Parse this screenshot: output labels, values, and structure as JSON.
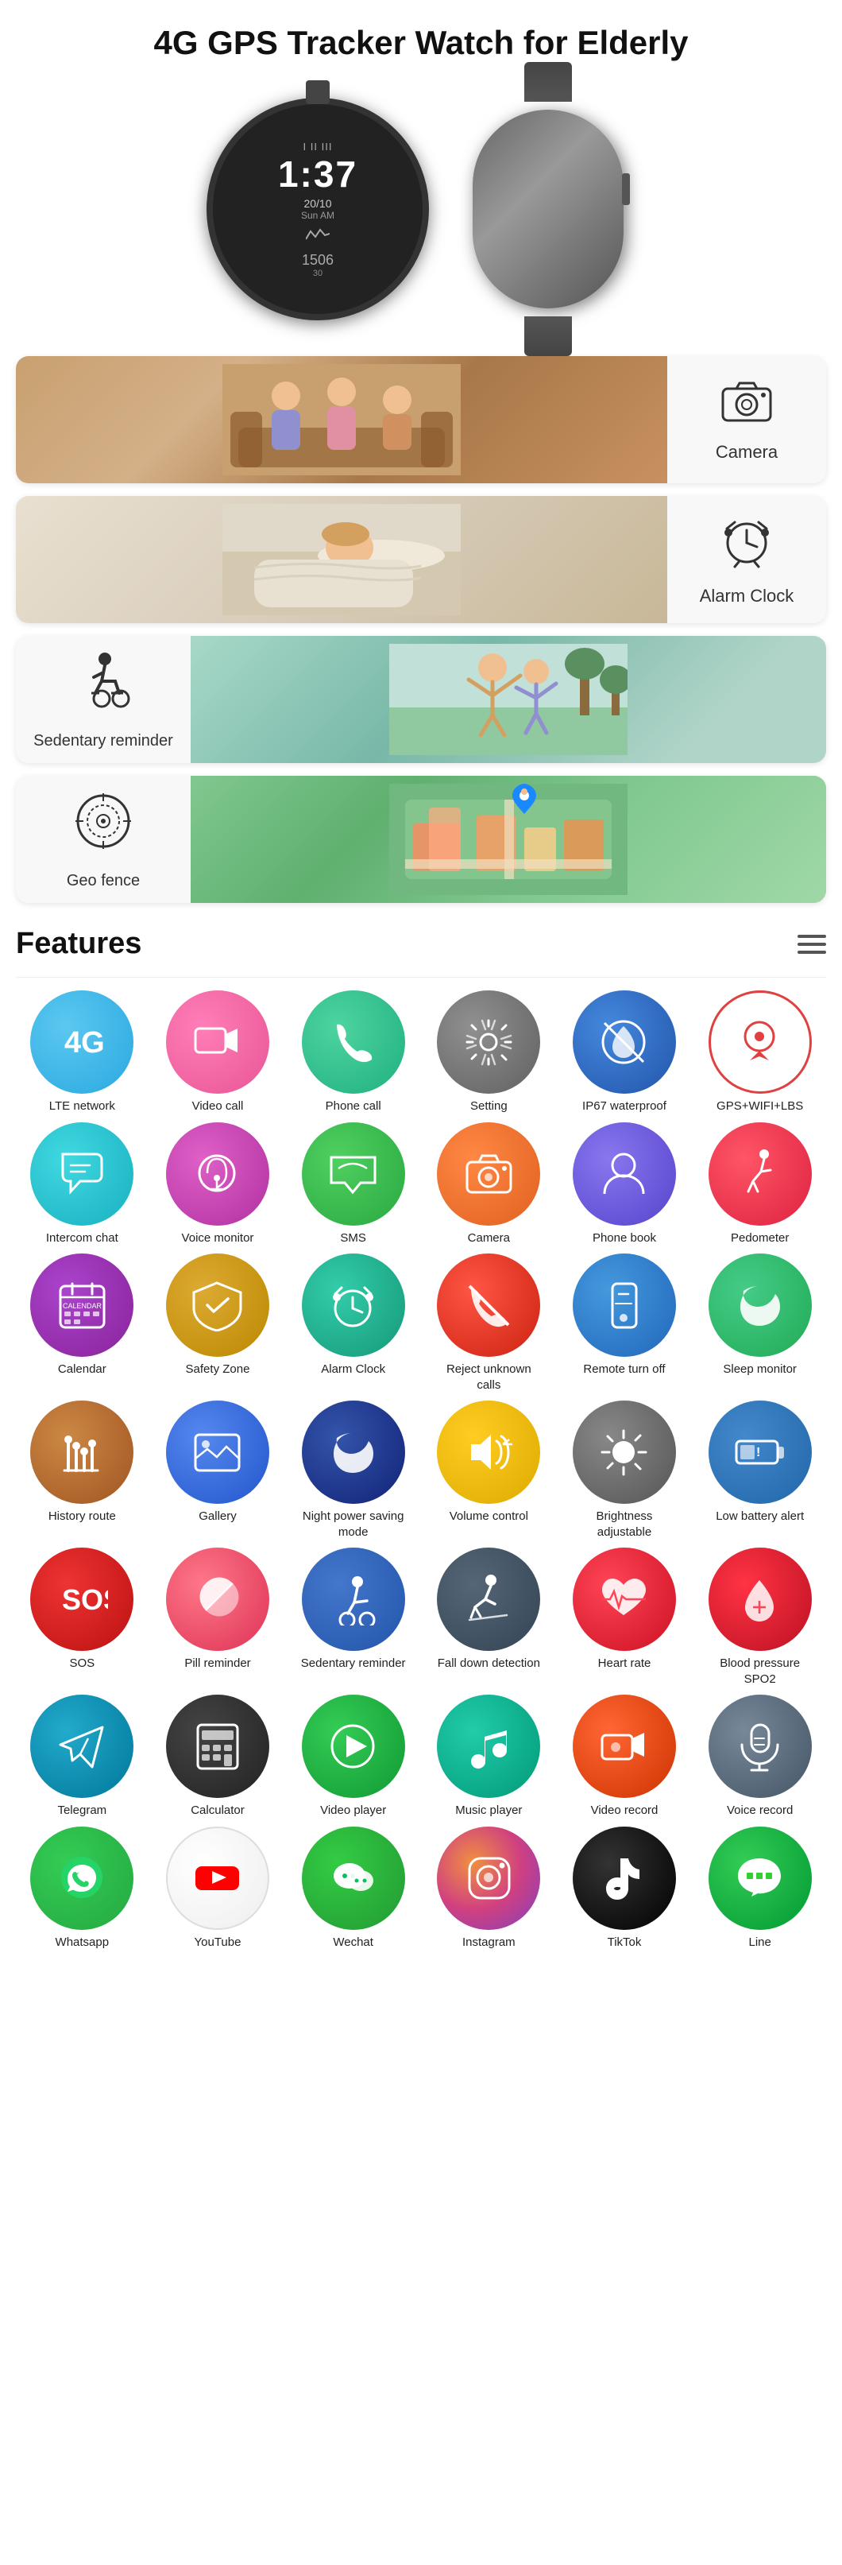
{
  "page": {
    "title": "4G GPS Tracker Watch for Elderly"
  },
  "watch": {
    "time": "1:37",
    "date": "20/10",
    "day": "Sun AM",
    "steps": "1506"
  },
  "feature_cards": [
    {
      "id": "camera",
      "label": "Camera",
      "icon": "📷",
      "image_type": "elderly",
      "icon_side": "right"
    },
    {
      "id": "alarm",
      "label": "Alarm Clock",
      "icon": "⏰",
      "image_type": "sleep",
      "icon_side": "right"
    },
    {
      "id": "sedentary",
      "label": "Sedentary reminder",
      "icon": "♿",
      "image_type": "stretch",
      "icon_side": "left"
    },
    {
      "id": "geofence",
      "label": "Geo fence",
      "icon": "🎯",
      "image_type": "map",
      "icon_side": "left"
    }
  ],
  "features_section": {
    "title": "Features"
  },
  "features": [
    {
      "id": "lte",
      "label": "LTE network",
      "color": "c-blue-light",
      "icon": "4G"
    },
    {
      "id": "video-call",
      "label": "Video call",
      "color": "c-pink",
      "icon": "📹"
    },
    {
      "id": "phone-call",
      "label": "Phone call",
      "color": "c-teal",
      "icon": "📞"
    },
    {
      "id": "setting",
      "label": "Setting",
      "color": "c-gray",
      "icon": "⚙️"
    },
    {
      "id": "waterproof",
      "label": "IP67 waterproof",
      "color": "c-navy",
      "icon": "🚫"
    },
    {
      "id": "gps",
      "label": "GPS+WIFI+LBS",
      "color": "c-red-outline",
      "icon": "📍"
    },
    {
      "id": "intercom",
      "label": "Intercom chat",
      "color": "c-cyan",
      "icon": "💬"
    },
    {
      "id": "voice-monitor",
      "label": "Voice monitor",
      "color": "c-magenta",
      "icon": "🎧"
    },
    {
      "id": "sms",
      "label": "SMS",
      "color": "c-green",
      "icon": "💬"
    },
    {
      "id": "camera2",
      "label": "Camera",
      "color": "c-orange-cam",
      "icon": "📷"
    },
    {
      "id": "phonebook",
      "label": "Phone book",
      "color": "c-purple-blue",
      "icon": "👤"
    },
    {
      "id": "pedometer",
      "label": "Pedometer",
      "color": "c-red-run",
      "icon": "🏃"
    },
    {
      "id": "calendar",
      "label": "Calendar",
      "color": "c-purple-cal",
      "icon": "📅"
    },
    {
      "id": "safety-zone",
      "label": "Safety Zone",
      "color": "c-gold",
      "icon": "⬡"
    },
    {
      "id": "alarm2",
      "label": "Alarm Clock",
      "color": "c-teal-alarm",
      "icon": "⏰"
    },
    {
      "id": "reject-calls",
      "label": "Reject unknown calls",
      "color": "c-red-reject",
      "icon": "📵"
    },
    {
      "id": "remote-off",
      "label": "Remote turn off",
      "color": "c-blue-remote",
      "icon": "📱"
    },
    {
      "id": "sleep",
      "label": "Sleep monitor",
      "color": "c-green-sleep",
      "icon": "😴"
    },
    {
      "id": "history",
      "label": "History route",
      "color": "c-brown",
      "icon": "👣"
    },
    {
      "id": "gallery",
      "label": "Gallery",
      "color": "c-blue-gallery",
      "icon": "🖼️"
    },
    {
      "id": "night-power",
      "label": "Night power saving mode",
      "color": "c-navy-night",
      "icon": "🌙"
    },
    {
      "id": "volume",
      "label": "Volume control",
      "color": "c-yellow",
      "icon": "🔊"
    },
    {
      "id": "brightness",
      "label": "Brightness adjustable",
      "color": "c-gray-bright",
      "icon": "☀️"
    },
    {
      "id": "battery",
      "label": "Low battery alert",
      "color": "c-blue-batt",
      "icon": "🔋"
    },
    {
      "id": "sos",
      "label": "SOS",
      "color": "c-red-sos",
      "icon": "SOS"
    },
    {
      "id": "pill",
      "label": "Pill reminder",
      "color": "c-pink-pill",
      "icon": "💊"
    },
    {
      "id": "sedentary2",
      "label": "Sedentary reminder",
      "color": "c-blue-sed",
      "icon": "🪑"
    },
    {
      "id": "falldown",
      "label": "Fall down detection",
      "color": "c-dark-walk",
      "icon": "🚶"
    },
    {
      "id": "heartrate",
      "label": "Heart rate",
      "color": "c-red-heart",
      "icon": "❤️"
    },
    {
      "id": "blood",
      "label": "Blood pressure SPO2",
      "color": "c-red-blood",
      "icon": "🩸"
    },
    {
      "id": "telegram",
      "label": "Telegram",
      "color": "c-teal-tel",
      "icon": "✈️"
    },
    {
      "id": "calculator",
      "label": "Calculator",
      "color": "c-dark-calc",
      "icon": "🧮"
    },
    {
      "id": "video-player",
      "label": "Video player",
      "color": "c-green-vid",
      "icon": "▶️"
    },
    {
      "id": "music",
      "label": "Music player",
      "color": "c-teal-music",
      "icon": "🎵"
    },
    {
      "id": "video-record",
      "label": "Video record",
      "color": "c-orange-vid",
      "icon": "🎬"
    },
    {
      "id": "voice-record",
      "label": "Voice record",
      "color": "c-gray-voice",
      "icon": "🎤"
    },
    {
      "id": "whatsapp",
      "label": "Whatsapp",
      "color": "c-green-wa",
      "icon": "WA"
    },
    {
      "id": "youtube",
      "label": "YouTube",
      "color": "c-red-yt",
      "icon": "YT"
    },
    {
      "id": "wechat",
      "label": "Wechat",
      "color": "c-green-wc",
      "icon": "WC"
    },
    {
      "id": "instagram",
      "label": "Instagram",
      "color": "c-grad-ig",
      "icon": "IG"
    },
    {
      "id": "tiktok",
      "label": "TikTok",
      "color": "c-black-tt",
      "icon": "TT"
    },
    {
      "id": "line",
      "label": "Line",
      "color": "c-green-line",
      "icon": "LN"
    }
  ]
}
